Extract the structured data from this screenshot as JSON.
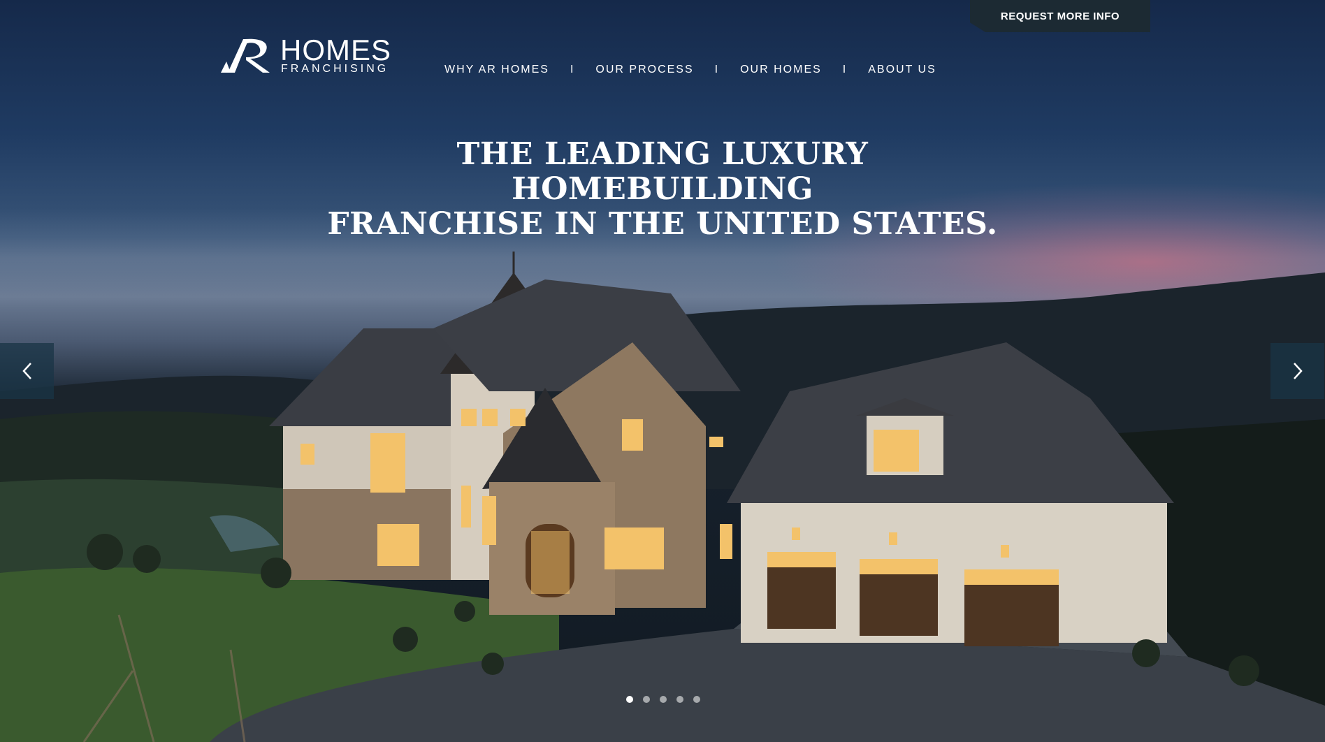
{
  "header": {
    "cta_label": "REQUEST MORE INFO",
    "logo": {
      "word_1": "HOMES",
      "word_2": "FRANCHISING",
      "mark_text": "AR"
    }
  },
  "nav": {
    "items": [
      {
        "label": "WHY AR HOMES"
      },
      {
        "label": "OUR PROCESS"
      },
      {
        "label": "OUR HOMES"
      },
      {
        "label": "ABOUT US"
      }
    ],
    "separator": "I"
  },
  "hero": {
    "headline_line_1": "THE LEADING LUXURY HOMEBUILDING",
    "headline_line_2": "FRANCHISE IN THE UNITED STATES."
  },
  "slider": {
    "prev_icon": "chevron-left-icon",
    "next_icon": "chevron-right-icon",
    "slide_count": 5,
    "active_slide": 1
  },
  "colors": {
    "cta_background": "#1c2a33",
    "arrow_background": "#1a3446",
    "text": "#ffffff"
  }
}
